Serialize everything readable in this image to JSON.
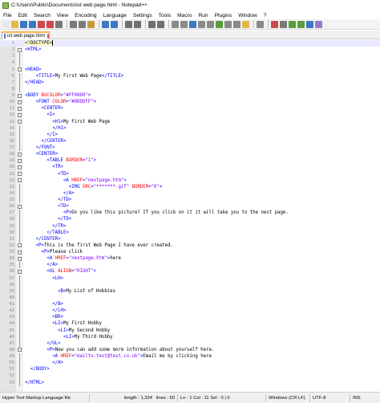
{
  "window": {
    "title": "C:\\Users\\Public\\Documents\\ist web page.html - Notepad++"
  },
  "menu": [
    "File",
    "Edit",
    "Search",
    "View",
    "Encoding",
    "Language",
    "Settings",
    "Tools",
    "Macro",
    "Run",
    "Plugins",
    "Window",
    "?"
  ],
  "toolbar": {
    "buttons": [
      {
        "name": "new-file-icon",
        "color": "#e8e8e8"
      },
      {
        "name": "open-file-icon",
        "color": "#e6b84a"
      },
      {
        "name": "save-icon",
        "color": "#3d78c4"
      },
      {
        "name": "save-all-icon",
        "color": "#3d78c4"
      },
      {
        "name": "close-icon",
        "color": "#cc4a4a"
      },
      {
        "name": "close-all-icon",
        "color": "#cc4a4a"
      },
      {
        "name": "print-icon",
        "color": "#7a7a7a"
      },
      {
        "sep": true
      },
      {
        "name": "cut-icon",
        "color": "#7a7a7a"
      },
      {
        "name": "copy-icon",
        "color": "#7a7a7a"
      },
      {
        "name": "paste-icon",
        "color": "#c99a3c"
      },
      {
        "sep": true
      },
      {
        "name": "undo-icon",
        "color": "#3d78c4"
      },
      {
        "name": "redo-icon",
        "color": "#3d78c4"
      },
      {
        "sep": true
      },
      {
        "name": "find-icon",
        "color": "#6f6f6f"
      },
      {
        "name": "replace-icon",
        "color": "#6f6f6f"
      },
      {
        "sep": true
      },
      {
        "name": "zoom-in-icon",
        "color": "#6f6f6f"
      },
      {
        "name": "zoom-out-icon",
        "color": "#6f6f6f"
      },
      {
        "sep": true
      },
      {
        "name": "sync-vertical-icon",
        "color": "#8a8a8a"
      },
      {
        "name": "sync-horizontal-icon",
        "color": "#8a8a8a"
      },
      {
        "name": "word-wrap-icon",
        "color": "#3d78c4"
      },
      {
        "name": "show-all-chars-icon",
        "color": "#8a8a8a"
      },
      {
        "name": "indent-guide-icon",
        "color": "#8a8a8a"
      },
      {
        "name": "user-lang-icon",
        "color": "#5a9e3a"
      },
      {
        "name": "doc-map-icon",
        "color": "#8a8a8a"
      },
      {
        "name": "function-list-icon",
        "color": "#8a8a8a"
      },
      {
        "name": "folder-workspace-icon",
        "color": "#e6b84a"
      },
      {
        "sep": true
      },
      {
        "name": "monitor-icon",
        "color": "#8a8a8a"
      },
      {
        "sep": true
      },
      {
        "name": "record-macro-icon",
        "color": "#cc4a4a"
      },
      {
        "name": "stop-record-icon",
        "color": "#7a7a7a"
      },
      {
        "name": "play-macro-icon",
        "color": "#5a9e3a"
      },
      {
        "name": "play-multiple-icon",
        "color": "#5a9e3a"
      },
      {
        "name": "save-macro-icon",
        "color": "#3d78c4"
      },
      {
        "name": "misc-icon",
        "color": "#9a7ac9"
      }
    ]
  },
  "tab": {
    "label": "ist web page.html"
  },
  "editor": {
    "current_line": 1,
    "lines": [
      {
        "n": "1",
        "fold": "none",
        "parts": [
          {
            "c": "t-doc",
            "t": "<!DOCTYPE>"
          }
        ]
      },
      {
        "n": "2",
        "fold": "box",
        "parts": [
          {
            "c": "t-tag",
            "t": "<HTML>"
          }
        ]
      },
      {
        "n": "3",
        "fold": "line",
        "parts": []
      },
      {
        "n": "4",
        "fold": "line",
        "parts": []
      },
      {
        "n": "5",
        "fold": "box",
        "parts": [
          {
            "c": "t-tag",
            "t": "<HEAD>"
          }
        ]
      },
      {
        "n": "6",
        "fold": "line",
        "parts": [
          {
            "c": "t-txt",
            "t": "    "
          },
          {
            "c": "t-tag",
            "t": "<TITLE>"
          },
          {
            "c": "t-txt",
            "t": "My First Web Page"
          },
          {
            "c": "t-tag",
            "t": "</TITLE>"
          }
        ]
      },
      {
        "n": "7",
        "fold": "line",
        "parts": [
          {
            "c": "t-tag",
            "t": "</HEAD>"
          }
        ]
      },
      {
        "n": "8",
        "fold": "line",
        "parts": []
      },
      {
        "n": "9",
        "fold": "box",
        "parts": [
          {
            "c": "t-tag",
            "t": "<BODY "
          },
          {
            "c": "t-attr",
            "t": "BGCOLOR"
          },
          {
            "c": "t-tag",
            "t": "="
          },
          {
            "c": "t-str",
            "t": "\"#FF00D0\""
          },
          {
            "c": "t-tag",
            "t": ">"
          }
        ]
      },
      {
        "n": "10",
        "fold": "box",
        "parts": [
          {
            "c": "t-txt",
            "t": "    "
          },
          {
            "c": "t-tag",
            "t": "<FONT "
          },
          {
            "c": "t-attr",
            "t": "COLOR"
          },
          {
            "c": "t-tag",
            "t": "="
          },
          {
            "c": "t-str",
            "t": "\"#0DDDFF\""
          },
          {
            "c": "t-tag",
            "t": ">"
          }
        ]
      },
      {
        "n": "11",
        "fold": "box",
        "parts": [
          {
            "c": "t-txt",
            "t": "      "
          },
          {
            "c": "t-tag",
            "t": "<CENTER>"
          }
        ]
      },
      {
        "n": "12",
        "fold": "box",
        "parts": [
          {
            "c": "t-txt",
            "t": "        "
          },
          {
            "c": "t-tag",
            "t": "<I>"
          }
        ]
      },
      {
        "n": "13",
        "fold": "box",
        "parts": [
          {
            "c": "t-txt",
            "t": "          "
          },
          {
            "c": "t-tag",
            "t": "<H1>"
          },
          {
            "c": "t-txt",
            "t": "My First Web Page"
          }
        ]
      },
      {
        "n": "14",
        "fold": "line",
        "parts": [
          {
            "c": "t-txt",
            "t": "          "
          },
          {
            "c": "t-tag",
            "t": "</H1>"
          }
        ]
      },
      {
        "n": "15",
        "fold": "line",
        "parts": [
          {
            "c": "t-txt",
            "t": "        "
          },
          {
            "c": "t-tag",
            "t": "</I>"
          }
        ]
      },
      {
        "n": "16",
        "fold": "line",
        "parts": [
          {
            "c": "t-txt",
            "t": "      "
          },
          {
            "c": "t-tag",
            "t": "</CENTER>"
          }
        ]
      },
      {
        "n": "17",
        "fold": "line",
        "parts": [
          {
            "c": "t-txt",
            "t": "    "
          },
          {
            "c": "t-tag",
            "t": "</FONT>"
          }
        ]
      },
      {
        "n": "18",
        "fold": "box",
        "parts": [
          {
            "c": "t-txt",
            "t": "    "
          },
          {
            "c": "t-tag",
            "t": "<CENTER>"
          }
        ]
      },
      {
        "n": "19",
        "fold": "box",
        "parts": [
          {
            "c": "t-txt",
            "t": "        "
          },
          {
            "c": "t-tag",
            "t": "<TABLE "
          },
          {
            "c": "t-attr",
            "t": "BORDER"
          },
          {
            "c": "t-tag",
            "t": "="
          },
          {
            "c": "t-str",
            "t": "\"1\""
          },
          {
            "c": "t-tag",
            "t": ">"
          }
        ]
      },
      {
        "n": "20",
        "fold": "box",
        "parts": [
          {
            "c": "t-txt",
            "t": "          "
          },
          {
            "c": "t-tag",
            "t": "<TR>"
          }
        ]
      },
      {
        "n": "21",
        "fold": "box",
        "parts": [
          {
            "c": "t-txt",
            "t": "            "
          },
          {
            "c": "t-tag",
            "t": "<TD>"
          }
        ]
      },
      {
        "n": "22",
        "fold": "box",
        "parts": [
          {
            "c": "t-txt",
            "t": "              "
          },
          {
            "c": "t-tag",
            "t": "<A "
          },
          {
            "c": "t-attr",
            "t": "HREF"
          },
          {
            "c": "t-tag",
            "t": "="
          },
          {
            "c": "t-str",
            "t": "\"nextpage.htm\""
          },
          {
            "c": "t-tag",
            "t": ">"
          }
        ]
      },
      {
        "n": "23",
        "fold": "line",
        "parts": [
          {
            "c": "t-txt",
            "t": "                "
          },
          {
            "c": "t-tag",
            "t": "<IMG "
          },
          {
            "c": "t-attr",
            "t": "SRC"
          },
          {
            "c": "t-tag",
            "t": "="
          },
          {
            "c": "t-str",
            "t": "\"*******.gif\""
          },
          {
            "c": "t-tag",
            "t": " "
          },
          {
            "c": "t-attr",
            "t": "BORDER"
          },
          {
            "c": "t-tag",
            "t": "="
          },
          {
            "c": "t-str",
            "t": "\"0\""
          },
          {
            "c": "t-tag",
            "t": ">"
          }
        ]
      },
      {
        "n": "24",
        "fold": "line",
        "parts": [
          {
            "c": "t-txt",
            "t": "              "
          },
          {
            "c": "t-tag",
            "t": "</A>"
          }
        ]
      },
      {
        "n": "25",
        "fold": "line",
        "parts": [
          {
            "c": "t-txt",
            "t": "            "
          },
          {
            "c": "t-tag",
            "t": "</TD>"
          }
        ]
      },
      {
        "n": "26",
        "fold": "box",
        "parts": [
          {
            "c": "t-txt",
            "t": "            "
          },
          {
            "c": "t-tag",
            "t": "<TD>"
          }
        ]
      },
      {
        "n": "27",
        "fold": "line",
        "parts": [
          {
            "c": "t-txt",
            "t": "              "
          },
          {
            "c": "t-tag",
            "t": "<P>"
          },
          {
            "c": "t-txt",
            "t": "Do you like this picture? If you click on it it will take you to the next page."
          }
        ]
      },
      {
        "n": "28",
        "fold": "line",
        "parts": [
          {
            "c": "t-txt",
            "t": "            "
          },
          {
            "c": "t-tag",
            "t": "</TD>"
          }
        ]
      },
      {
        "n": "29",
        "fold": "line",
        "parts": [
          {
            "c": "t-txt",
            "t": "          "
          },
          {
            "c": "t-tag",
            "t": "</TR>"
          }
        ]
      },
      {
        "n": "30",
        "fold": "line",
        "parts": [
          {
            "c": "t-txt",
            "t": "        "
          },
          {
            "c": "t-tag",
            "t": "</TABLE>"
          }
        ]
      },
      {
        "n": "31",
        "fold": "line",
        "parts": [
          {
            "c": "t-txt",
            "t": "    "
          },
          {
            "c": "t-tag",
            "t": "</CENTER>"
          }
        ]
      },
      {
        "n": "32",
        "fold": "box",
        "parts": [
          {
            "c": "t-txt",
            "t": "    "
          },
          {
            "c": "t-tag",
            "t": "<P>"
          },
          {
            "c": "t-txt",
            "t": "This is the first Web Page I have ever created."
          }
        ]
      },
      {
        "n": "33",
        "fold": "box",
        "parts": [
          {
            "c": "t-txt",
            "t": "      "
          },
          {
            "c": "t-tag",
            "t": "<P>"
          },
          {
            "c": "t-txt",
            "t": "Please click"
          }
        ]
      },
      {
        "n": "34",
        "fold": "box",
        "parts": [
          {
            "c": "t-txt",
            "t": "        "
          },
          {
            "c": "t-tag",
            "t": "<A "
          },
          {
            "c": "t-attr",
            "t": "HREF"
          },
          {
            "c": "t-tag",
            "t": "="
          },
          {
            "c": "t-str",
            "t": "\"nextpage.htm\""
          },
          {
            "c": "t-tag",
            "t": ">"
          },
          {
            "c": "t-txt",
            "t": "here"
          }
        ]
      },
      {
        "n": "35",
        "fold": "line",
        "parts": [
          {
            "c": "t-txt",
            "t": "        "
          },
          {
            "c": "t-tag",
            "t": "</A>"
          }
        ]
      },
      {
        "n": "36",
        "fold": "box",
        "parts": [
          {
            "c": "t-txt",
            "t": "        "
          },
          {
            "c": "t-tag",
            "t": "<UL "
          },
          {
            "c": "t-attr",
            "t": "ALIGN"
          },
          {
            "c": "t-tag",
            "t": "="
          },
          {
            "c": "t-str",
            "t": "\"RIGHT\""
          },
          {
            "c": "t-tag",
            "t": ">"
          }
        ]
      },
      {
        "n": "37",
        "fold": "line",
        "parts": [
          {
            "c": "t-txt",
            "t": "          "
          },
          {
            "c": "t-tag",
            "t": "<LH>"
          }
        ]
      },
      {
        "n": "38",
        "fold": "line",
        "parts": []
      },
      {
        "n": "39",
        "fold": "line",
        "parts": [
          {
            "c": "t-txt",
            "t": "            "
          },
          {
            "c": "t-tag",
            "t": "<B>"
          },
          {
            "c": "t-txt",
            "t": "My List of Hobbies"
          }
        ]
      },
      {
        "n": "40",
        "fold": "line",
        "parts": []
      },
      {
        "n": "41",
        "fold": "line",
        "parts": [
          {
            "c": "t-txt",
            "t": "          "
          },
          {
            "c": "t-tag",
            "t": "</B>"
          }
        ]
      },
      {
        "n": "42",
        "fold": "line",
        "parts": [
          {
            "c": "t-txt",
            "t": "          "
          },
          {
            "c": "t-tag",
            "t": "</LH>"
          }
        ]
      },
      {
        "n": "43",
        "fold": "line",
        "parts": [
          {
            "c": "t-txt",
            "t": "          "
          },
          {
            "c": "t-tag",
            "t": "<BR>"
          }
        ]
      },
      {
        "n": "44",
        "fold": "line",
        "parts": [
          {
            "c": "t-txt",
            "t": "          "
          },
          {
            "c": "t-tag",
            "t": "<LI>"
          },
          {
            "c": "t-txt",
            "t": "My First Hobby"
          }
        ]
      },
      {
        "n": "45",
        "fold": "line",
        "parts": [
          {
            "c": "t-txt",
            "t": "            "
          },
          {
            "c": "t-tag",
            "t": "<LI>"
          },
          {
            "c": "t-txt",
            "t": "My Second Hobby"
          }
        ]
      },
      {
        "n": "46",
        "fold": "line",
        "parts": [
          {
            "c": "t-txt",
            "t": "              "
          },
          {
            "c": "t-tag",
            "t": "<LI>"
          },
          {
            "c": "t-txt",
            "t": "My Third Hobby"
          }
        ]
      },
      {
        "n": "47",
        "fold": "line",
        "parts": [
          {
            "c": "t-txt",
            "t": "        "
          },
          {
            "c": "t-tag",
            "t": "</UL>"
          }
        ]
      },
      {
        "n": "48",
        "fold": "box",
        "parts": [
          {
            "c": "t-txt",
            "t": "        "
          },
          {
            "c": "t-tag",
            "t": "<P>"
          },
          {
            "c": "t-txt",
            "t": "Now you can add some more information about yourself here."
          }
        ]
      },
      {
        "n": "49",
        "fold": "line",
        "parts": [
          {
            "c": "t-txt",
            "t": "          "
          },
          {
            "c": "t-tag",
            "t": "<A "
          },
          {
            "c": "t-attr",
            "t": "HREF"
          },
          {
            "c": "t-tag",
            "t": "="
          },
          {
            "c": "t-str",
            "t": "\"mailto:test@test.co.uk\""
          },
          {
            "c": "t-tag",
            "t": ">"
          },
          {
            "c": "t-txt",
            "t": "Email me by clicking here"
          }
        ]
      },
      {
        "n": "50",
        "fold": "line",
        "parts": [
          {
            "c": "t-txt",
            "t": "          "
          },
          {
            "c": "t-tag",
            "t": "</A>"
          }
        ]
      },
      {
        "n": "51",
        "fold": "line",
        "parts": [
          {
            "c": "t-txt",
            "t": "  "
          },
          {
            "c": "t-tag",
            "t": "</BODY>"
          }
        ]
      },
      {
        "n": "52",
        "fold": "line",
        "parts": []
      },
      {
        "n": "53",
        "fold": "line",
        "parts": [
          {
            "c": "t-tag",
            "t": "</HTML>"
          }
        ]
      }
    ]
  },
  "status": {
    "file_type": "Hyper Text Markup Language file",
    "length": "length : 1,334",
    "lines": "lines : 50",
    "position": "Ln : 1    Col : 11    Sel : 0 | 0",
    "eol": "Windows (CR LF)",
    "encoding": "UTF-8",
    "mode": "INS"
  },
  "colors": {
    "tag": "#0000ff",
    "attribute": "#ff0000",
    "string": "#8000ff",
    "text": "#000000",
    "active_tab_accent": "#f7b64f"
  }
}
